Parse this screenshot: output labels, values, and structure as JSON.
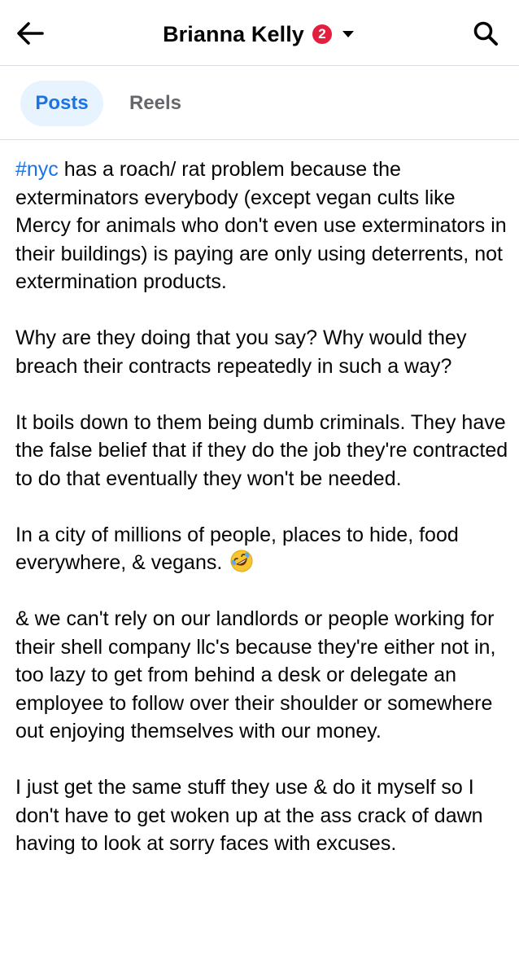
{
  "header": {
    "title": "Brianna Kelly",
    "badge_count": "2",
    "back_icon": "arrow-left-icon",
    "dropdown_icon": "caret-down-icon",
    "search_icon": "search-icon"
  },
  "tabs": [
    {
      "label": "Posts",
      "active": true
    },
    {
      "label": "Reels",
      "active": false
    }
  ],
  "post": {
    "hashtag": "#nyc",
    "p1_rest": " has a roach/ rat problem because the exterminators everybody (except vegan cults like Mercy for animals who don't even use exterminators in their buildings) is paying are only using deterrents, not extermination products.",
    "p2": "Why are they doing that you say? Why would they breach their contracts repeatedly in such a way?",
    "p3": "It boils down to them being dumb criminals. They have the false belief that if they do the job they're contracted to do that eventually they won't be needed.",
    "p4": "In a city of millions of people, places to hide, food everywhere, & vegans.",
    "p4_emoji": "rolling-on-floor-laughing-emoji",
    "p5": "& we can't rely on our landlords or people working for their shell company llc's because they're either not in, too lazy to get from behind a desk or delegate an employee to follow over their shoulder or somewhere out enjoying themselves with our money.",
    "p6": "I just get the same stuff they use & do it myself so I don't have to get woken up at the ass crack of dawn having to look at sorry faces with excuses."
  },
  "colors": {
    "accent": "#1b74e4",
    "tab_active_bg": "#e7f3ff",
    "badge": "#e41e3f",
    "text": "#050505",
    "muted": "#65676b"
  }
}
